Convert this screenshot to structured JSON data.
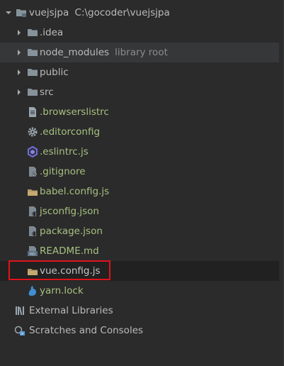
{
  "project": {
    "name": "vuejsjpa",
    "path": "C:\\gocoder\\vuejsjpa"
  },
  "folders": [
    {
      "label": ".idea"
    },
    {
      "label": "node_modules",
      "secondary": "library root"
    },
    {
      "label": "public"
    },
    {
      "label": "src"
    }
  ],
  "files": [
    {
      "label": ".browserslistrc",
      "icon": "text-file-icon"
    },
    {
      "label": ".editorconfig",
      "icon": "gear-icon"
    },
    {
      "label": ".eslintrc.js",
      "icon": "eslint-icon"
    },
    {
      "label": ".gitignore",
      "icon": "ignore-file-icon"
    },
    {
      "label": "babel.config.js",
      "icon": "config-folder-icon"
    },
    {
      "label": "jsconfig.json",
      "icon": "json-file-icon"
    },
    {
      "label": "package.json",
      "icon": "json-file-icon"
    },
    {
      "label": "README.md",
      "icon": "markdown-file-icon"
    },
    {
      "label": "vue.config.js",
      "icon": "config-folder-icon"
    },
    {
      "label": "yarn.lock",
      "icon": "yarn-icon"
    }
  ],
  "external_libraries": {
    "label": "External Libraries"
  },
  "scratches": {
    "label": "Scratches and Consoles"
  },
  "colors": {
    "background": "#2b2b2b",
    "highlight_row": "#353739",
    "file_text": "#a7c080",
    "folder_text": "#bbbbbb",
    "annotation_box": "#e0121b"
  }
}
